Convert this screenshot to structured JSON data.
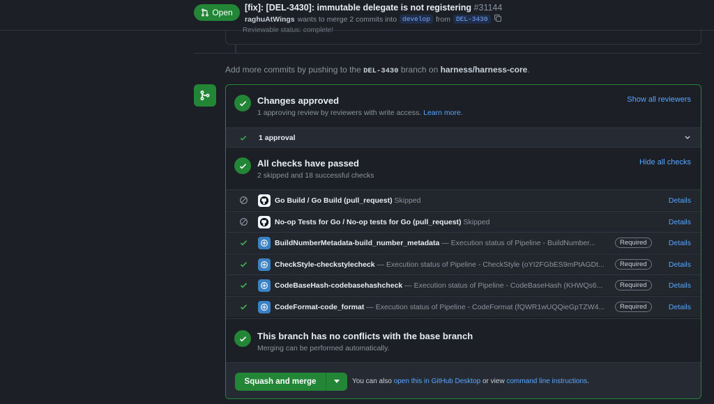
{
  "header": {
    "status": "Open",
    "title": "[fix]: [DEL-3430]: immutable delegate is not registering",
    "number": "#31144",
    "author": "raghuAtWings",
    "merge_text": "wants to merge 2 commits into",
    "base_branch": "develop",
    "from_text": "from",
    "head_branch": "DEL-3430"
  },
  "timeline": {
    "cut_text": "Reviewable status: complete!",
    "add_commits_prefix": "Add more commits by pushing to the",
    "add_commits_branch": "DEL-3430",
    "add_commits_mid": "branch on",
    "add_commits_repo": "harness/harness-core",
    "add_commits_end": "."
  },
  "approval": {
    "title": "Changes approved",
    "subtitle": "1 approving review by reviewers with write access.",
    "learn_more": "Learn more.",
    "show_reviewers": "Show all reviewers",
    "approval_count": "1 approval"
  },
  "checks": {
    "title": "All checks have passed",
    "subtitle": "2 skipped and 18 successful checks",
    "hide_link": "Hide all checks",
    "details_label": "Details",
    "required_label": "Required",
    "rows": [
      {
        "status": "skipped",
        "app": "github",
        "name": "Go Build / Go Build (pull_request)",
        "desc": "Skipped",
        "required": false
      },
      {
        "status": "skipped",
        "app": "github",
        "name": "No-op Tests for Go / No-op tests for Go (pull_request)",
        "desc": "Skipped",
        "required": false
      },
      {
        "status": "success",
        "app": "harness",
        "name": "BuildNumberMetadata-build_number_metadata",
        "desc": "— Execution status of Pipeline - BuildNumber...",
        "required": true
      },
      {
        "status": "success",
        "app": "harness",
        "name": "CheckStyle-checkstylecheck",
        "desc": "— Execution status of Pipeline - CheckStyle (oYI2FGbES9mPtAGDt...",
        "required": true
      },
      {
        "status": "success",
        "app": "harness",
        "name": "CodeBaseHash-codebasehashcheck",
        "desc": "— Execution status of Pipeline - CodeBaseHash (KHWQs6...",
        "required": true
      },
      {
        "status": "success",
        "app": "harness",
        "name": "CodeFormat-code_format",
        "desc": "— Execution status of Pipeline - CodeFormat (fQWR1wUQQieGpTZW4...",
        "required": true
      }
    ]
  },
  "conflicts": {
    "title": "This branch has no conflicts with the base branch",
    "subtitle": "Merging can be performed automatically."
  },
  "merge": {
    "button_label": "Squash and merge",
    "also_text": "You can also",
    "desktop_link": "open this in GitHub Desktop",
    "or_view": "or view",
    "cli_link": "command line instructions",
    "end": "."
  },
  "colors": {
    "success": "#238636",
    "link": "#58a6ff",
    "background": "#1c1f26"
  }
}
